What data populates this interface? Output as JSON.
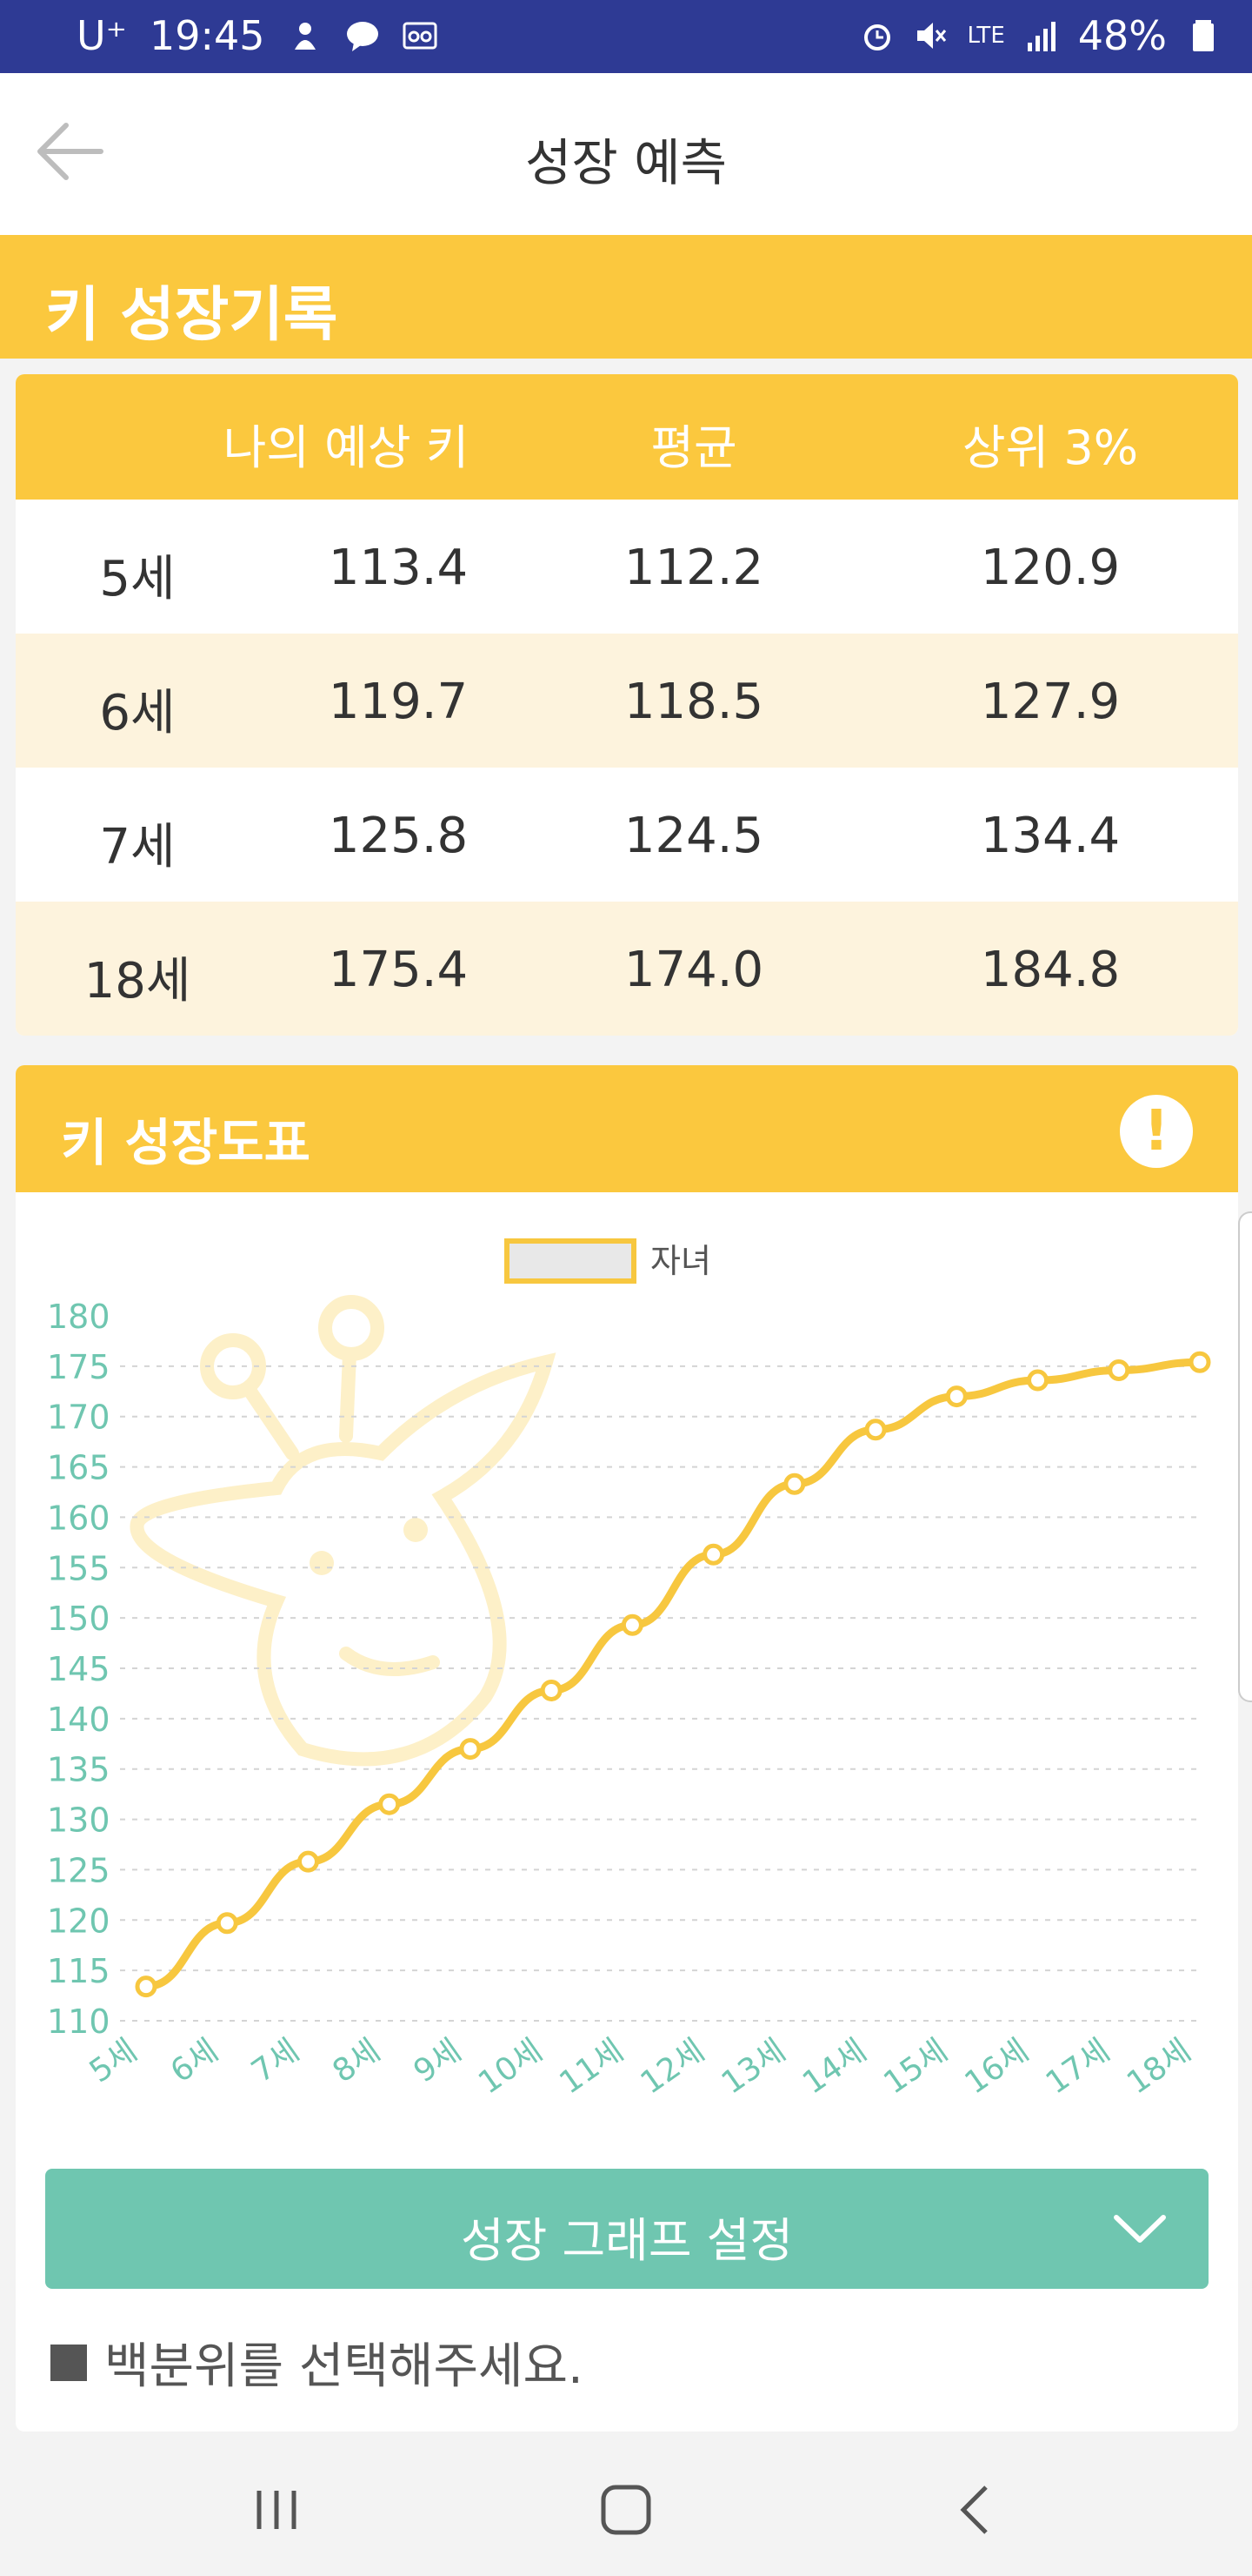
{
  "status_bar": {
    "carrier": "U⁺",
    "time": "19:45",
    "network": "LTE",
    "battery": "48%"
  },
  "app_bar": {
    "title": "성장 예측"
  },
  "height_record": {
    "title": "키 성장기록",
    "headers": [
      "",
      "나의 예상 키",
      "평균",
      "상위 3%"
    ],
    "rows": [
      {
        "age": "5세",
        "mine": "113.4",
        "avg": "112.2",
        "top3": "120.9"
      },
      {
        "age": "6세",
        "mine": "119.7",
        "avg": "118.5",
        "top3": "127.9"
      },
      {
        "age": "7세",
        "mine": "125.8",
        "avg": "124.5",
        "top3": "134.4"
      },
      {
        "age": "18세",
        "mine": "175.4",
        "avg": "174.0",
        "top3": "184.8"
      }
    ]
  },
  "growth_chart": {
    "title": "키 성장도표",
    "settings_button": "성장 그래프 설정",
    "percentile_prompt": "백분위를 선택해주세요."
  },
  "chart_data": {
    "type": "line",
    "title": "",
    "xlabel": "",
    "ylabel": "",
    "x": [
      "5세",
      "6세",
      "7세",
      "8세",
      "9세",
      "10세",
      "11세",
      "12세",
      "13세",
      "14세",
      "15세",
      "16세",
      "17세",
      "18세"
    ],
    "series": [
      {
        "name": "자녀",
        "values": [
          113.4,
          119.7,
          125.8,
          131.5,
          137.0,
          142.8,
          149.3,
          156.3,
          163.3,
          168.7,
          172.0,
          173.6,
          174.6,
          175.4
        ]
      }
    ],
    "ylim": [
      110,
      180
    ],
    "yticks": [
      110,
      115,
      120,
      125,
      130,
      135,
      140,
      145,
      150,
      155,
      160,
      165,
      170,
      175,
      180
    ],
    "grid": true,
    "legend": "top-center",
    "colors": {
      "line": "#f7c73f",
      "axis_labels": "#6fc6b0",
      "grid": "#d4d4d4"
    }
  }
}
